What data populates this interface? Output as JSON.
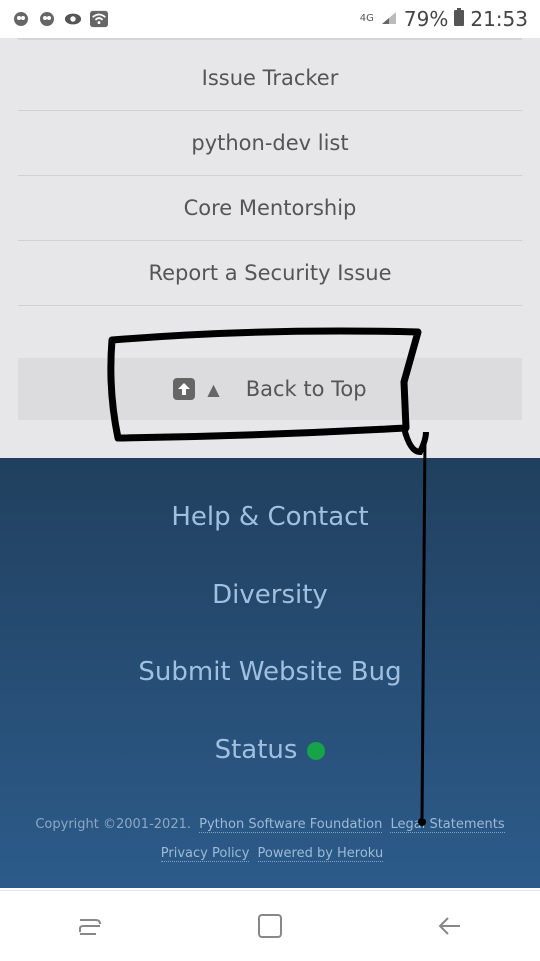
{
  "status_bar": {
    "network": "4G",
    "battery": "79%",
    "time": "21:53",
    "left_icons": [
      "notification-icon",
      "notification-icon",
      "eye-icon",
      "wifi-icon"
    ]
  },
  "nav": {
    "items": [
      {
        "label": "Issue Tracker"
      },
      {
        "label": "python-dev list"
      },
      {
        "label": "Core Mentorship"
      },
      {
        "label": "Report a Security Issue"
      }
    ]
  },
  "back_to_top": {
    "label": "Back to Top",
    "icon": "up-arrow-icon"
  },
  "footer": {
    "links": [
      {
        "label": "Help & Contact"
      },
      {
        "label": "Diversity"
      },
      {
        "label": "Submit Website Bug"
      },
      {
        "label": "Status"
      }
    ],
    "status_color": "#16a34a",
    "copyright": "Copyright ©2001-2021.",
    "psf": "Python Software Foundation",
    "legal": "Legal Statements",
    "privacy": "Privacy Policy",
    "heroku": "Powered by Heroku"
  },
  "colors": {
    "footer_top": "#21405f",
    "footer_bottom": "#2c5b8a",
    "link": "#9fc0e0",
    "grey_bg": "#e7e7e9"
  }
}
